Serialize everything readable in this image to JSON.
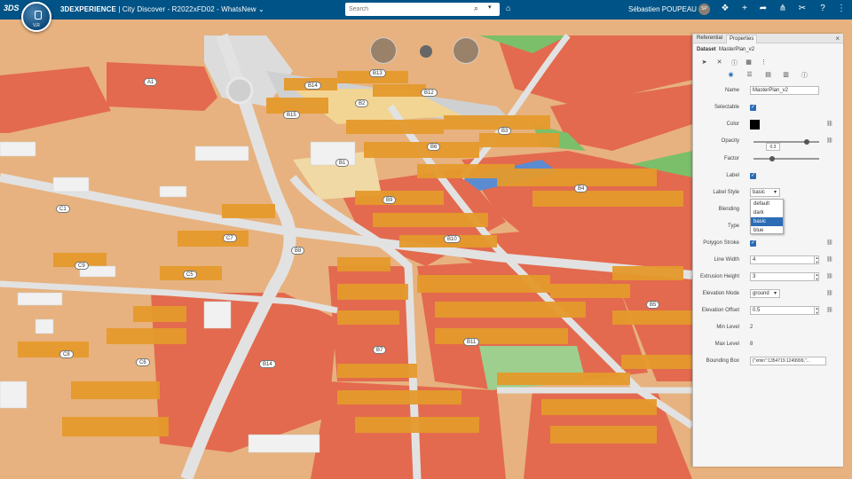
{
  "topbar": {
    "logo_text": "3DS",
    "compass_label": "V,R",
    "app_brand": "3DEXPERIENCE",
    "app_rest": " | City Discover - R2022xFD02 - WhatsNew",
    "search_placeholder": "Search",
    "user_name": "Sébastien POUPEAU",
    "user_initials": "SP",
    "icons": [
      "tag-icon",
      "bookmark-icon",
      "add-icon",
      "share-arrow-icon",
      "network-share-icon",
      "tools-icon",
      "help-icon",
      "apps-grid-icon"
    ],
    "bg": "#005386"
  },
  "map": {
    "building_labels": [
      "A1",
      "B13",
      "B14",
      "B2",
      "B12",
      "B15",
      "B3",
      "B6",
      "B1",
      "B4",
      "B9",
      "C1",
      "C7",
      "B10",
      "B8",
      "C9",
      "C5",
      "B5",
      "B11",
      "C8",
      "C6",
      "B7",
      "B14"
    ]
  },
  "panel": {
    "tabs": [
      "Referential",
      "Properties"
    ],
    "active_tab": "Properties",
    "dataset_label": "Dataset",
    "dataset_name": "MasterPlan_v2",
    "properties": [
      {
        "label": "Name",
        "value": "MasterPlan_v2"
      },
      {
        "label": "Selectable",
        "value": "checked"
      },
      {
        "label": "Color",
        "value": "#000000"
      },
      {
        "label": "Opacity",
        "value": "0.3"
      },
      {
        "label": "Factor",
        "value": ""
      },
      {
        "label": "Label",
        "value": "checked"
      },
      {
        "label": "Label Style",
        "value": "basic"
      },
      {
        "label": "Blending",
        "value": ""
      },
      {
        "label": "Type",
        "value": ""
      },
      {
        "label": "Polygon Stroke",
        "value": "checked"
      },
      {
        "label": "Line Width",
        "value": "4"
      },
      {
        "label": "Extrusion Height",
        "value": "3"
      },
      {
        "label": "Elevation Mode",
        "value": "ground"
      },
      {
        "label": "Elevation Offset",
        "value": "0.5"
      },
      {
        "label": "Min Level",
        "value": "2"
      },
      {
        "label": "Max Level",
        "value": "8"
      },
      {
        "label": "Bounding Box",
        "value": "{\"xmin\":1354719.1249999,\"..."
      }
    ],
    "label_style_options": [
      "default",
      "dark",
      "basic",
      "blue"
    ],
    "label_style_selected": "basic"
  }
}
